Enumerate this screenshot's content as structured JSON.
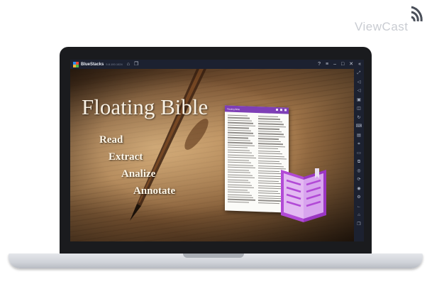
{
  "watermark": {
    "text": "ViewCast"
  },
  "window": {
    "app_name": "BlueStacks",
    "app_version": "5.8.100.1024",
    "title_icons": [
      "home-icon",
      "multi-instance-icon"
    ],
    "controls": [
      "help-icon",
      "menu-icon",
      "minimize-icon",
      "maximize-icon",
      "close-icon",
      "collapse-sidebar-icon"
    ]
  },
  "sidebar": {
    "tools": [
      "fullscreen-icon",
      "volume-up-icon",
      "volume-down-icon",
      "media-icon",
      "screenshot-icon",
      "rotate-icon",
      "keyboard-icon",
      "apk-icon",
      "scan-icon",
      "folder-icon",
      "copy-icon",
      "macro-icon",
      "sync-icon",
      "location-icon",
      "settings-icon",
      "back-icon",
      "home-icon",
      "recent-apps-icon"
    ]
  },
  "promo": {
    "headline": "Floating Bible",
    "verbs": [
      "Read",
      "Extract",
      "Analize",
      "Annotate"
    ],
    "phone_title": "Floating Bible"
  },
  "colors": {
    "accent_purple": "#7e3fb6",
    "book_purple": "#b24ad6",
    "titlebar": "#1c2130"
  }
}
